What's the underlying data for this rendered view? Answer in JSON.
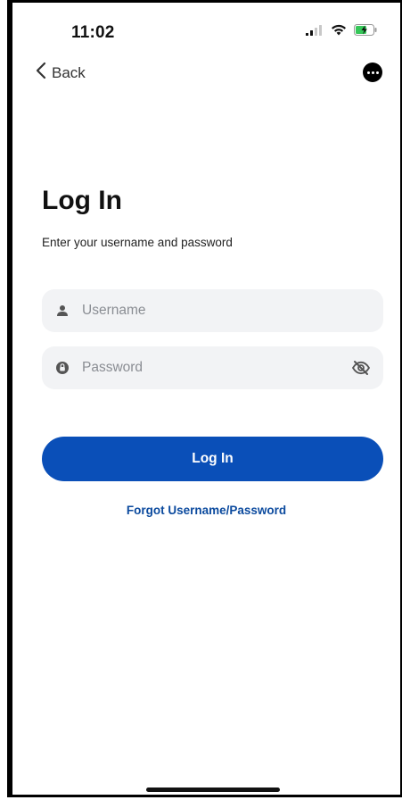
{
  "status_bar": {
    "time": "11:02"
  },
  "nav": {
    "back_label": "Back"
  },
  "login": {
    "title": "Log In",
    "subtitle": "Enter your username and password",
    "username_placeholder": "Username",
    "password_placeholder": "Password",
    "submit_label": "Log In",
    "forgot_label": "Forgot Username/Password"
  },
  "icons": {
    "back": "chevron-left-icon",
    "more": "more-options-icon",
    "username": "user-icon",
    "password": "lock-icon",
    "toggle_visibility": "eye-off-icon"
  },
  "colors": {
    "primary": "#0a4fb8",
    "link": "#0b4a9e",
    "field_bg": "#f2f3f5",
    "battery": "#36c759"
  }
}
